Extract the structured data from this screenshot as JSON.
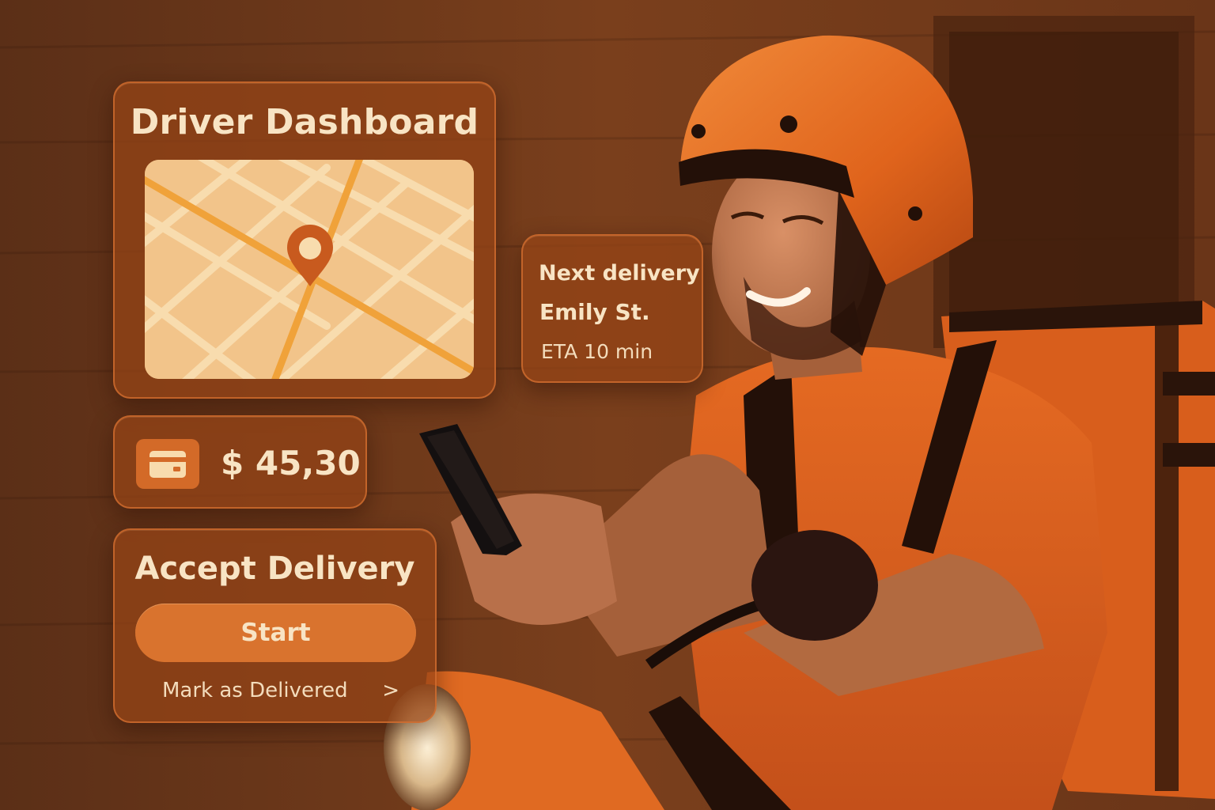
{
  "dashboard": {
    "title": "Driver Dashboard",
    "map_icon": "map-pin-icon"
  },
  "next_delivery": {
    "heading": "Next delivery",
    "street": "Emily St.",
    "eta": "ETA 10 min"
  },
  "earnings": {
    "icon": "wallet-icon",
    "amount": "$ 45,30"
  },
  "accept": {
    "title": "Accept Delivery",
    "start_label": "Start",
    "mark_delivered_label": "Mark as Delivered",
    "chevron": ">"
  },
  "colors": {
    "panel": "#96441a",
    "accent": "#d9732e",
    "text": "#f8e4c4",
    "map_bg": "#f2c48a",
    "map_road": "#f0a23a"
  }
}
